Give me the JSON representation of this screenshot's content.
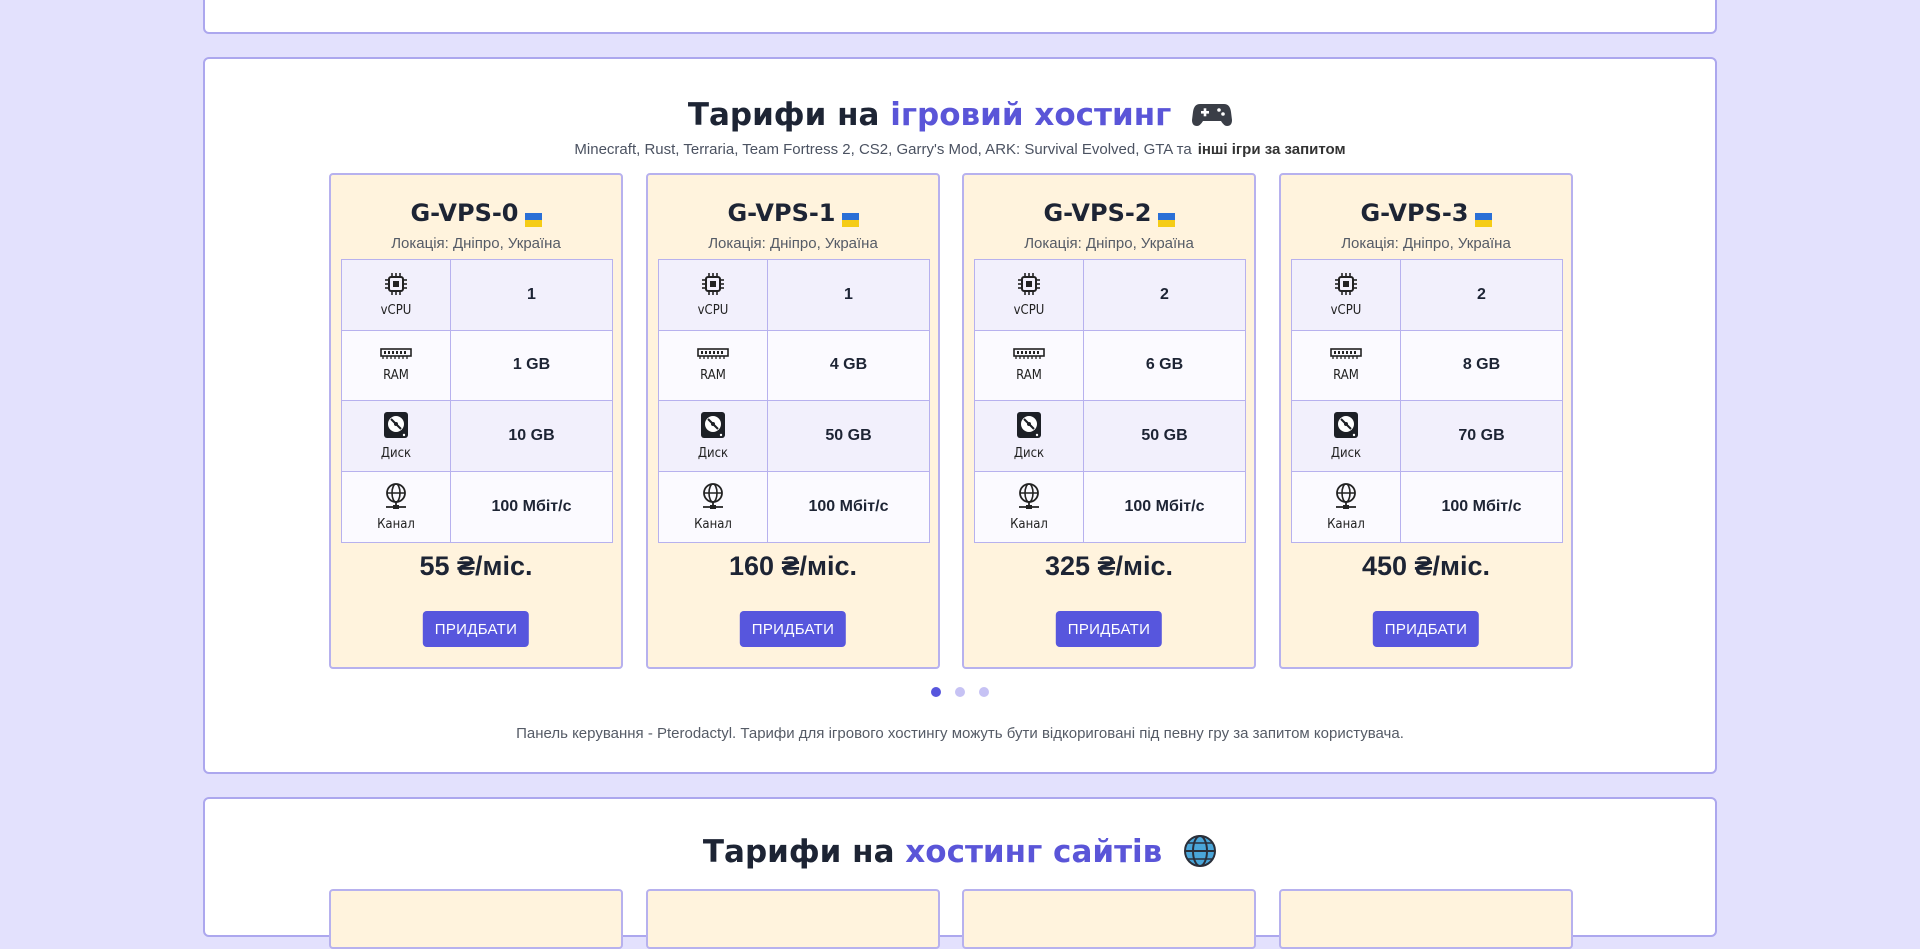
{
  "game_section": {
    "title_prefix": "Тарифи на",
    "title_accent": "ігровий хостинг",
    "title_icon": "game-controller-icon",
    "subtitle": "Minecraft, Rust, Terraria, Team Fortress 2, CS2, Garry's Mod, ARK: Survival Evolved, GTA та",
    "subtitle_link": "інші ігри за запитом",
    "plans": [
      {
        "name": "G-VPS-0",
        "flag_icon": "ukraine-flag-icon",
        "location": "Локація: Дніпро, Україна",
        "specs": [
          {
            "icon": "cpu-icon",
            "label": "vCPU",
            "value": "1"
          },
          {
            "icon": "ram-icon",
            "label": "RAM",
            "value": "1 GB"
          },
          {
            "icon": "disk-icon",
            "label": "Диск",
            "value": "10 GB"
          },
          {
            "icon": "network-icon",
            "label": "Канал",
            "value": "100 Мбіт/с"
          }
        ],
        "price": "55 ₴/міс.",
        "buy_label": "ПРИДБАТИ"
      },
      {
        "name": "G-VPS-1",
        "flag_icon": "ukraine-flag-icon",
        "location": "Локація: Дніпро, Україна",
        "specs": [
          {
            "icon": "cpu-icon",
            "label": "vCPU",
            "value": "1"
          },
          {
            "icon": "ram-icon",
            "label": "RAM",
            "value": "4 GB"
          },
          {
            "icon": "disk-icon",
            "label": "Диск",
            "value": "50 GB"
          },
          {
            "icon": "network-icon",
            "label": "Канал",
            "value": "100 Мбіт/с"
          }
        ],
        "price": "160 ₴/міс.",
        "buy_label": "ПРИДБАТИ"
      },
      {
        "name": "G-VPS-2",
        "flag_icon": "ukraine-flag-icon",
        "location": "Локація: Дніпро, Україна",
        "specs": [
          {
            "icon": "cpu-icon",
            "label": "vCPU",
            "value": "2"
          },
          {
            "icon": "ram-icon",
            "label": "RAM",
            "value": "6 GB"
          },
          {
            "icon": "disk-icon",
            "label": "Диск",
            "value": "50 GB"
          },
          {
            "icon": "network-icon",
            "label": "Канал",
            "value": "100 Мбіт/с"
          }
        ],
        "price": "325 ₴/міс.",
        "buy_label": "ПРИДБАТИ"
      },
      {
        "name": "G-VPS-3",
        "flag_icon": "ukraine-flag-icon",
        "location": "Локація: Дніпро, Україна",
        "specs": [
          {
            "icon": "cpu-icon",
            "label": "vCPU",
            "value": "2"
          },
          {
            "icon": "ram-icon",
            "label": "RAM",
            "value": "8 GB"
          },
          {
            "icon": "disk-icon",
            "label": "Диск",
            "value": "70 GB"
          },
          {
            "icon": "network-icon",
            "label": "Канал",
            "value": "100 Мбіт/с"
          }
        ],
        "price": "450 ₴/міс.",
        "buy_label": "ПРИДБАТИ"
      }
    ],
    "carousel": {
      "pages": 3,
      "active": 1
    },
    "note": "Панель керування - Pterodactyl. Тарифи для ігрового хостингу можуть бути відкориговані під певну гру за запитом користувача."
  },
  "web_section": {
    "title_prefix": "Тарифи на",
    "title_accent": "хостинг сайтів",
    "title_icon": "globe-icon"
  },
  "colors": {
    "page_bg": "#e3e1fd",
    "accent": "#5a55d8",
    "card_bg": "#fff3dd",
    "button": "#5756dd",
    "border": "#aca7ee"
  }
}
